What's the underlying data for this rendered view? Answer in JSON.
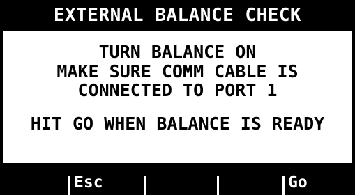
{
  "header": {
    "title": "EXTERNAL BALANCE CHECK"
  },
  "message": {
    "line1": "TURN BALANCE ON",
    "line2": "MAKE SURE COMM CABLE IS",
    "line3": "CONNECTED TO PORT 1",
    "line4": "HIT GO WHEN BALANCE IS READY"
  },
  "softkeys": {
    "key1": "Esc",
    "key2": "",
    "key3": "",
    "key4": "Go"
  },
  "colors": {
    "background": "#000000",
    "panel": "#ffffff",
    "text": "#000000",
    "inverse_text": "#ffffff"
  }
}
